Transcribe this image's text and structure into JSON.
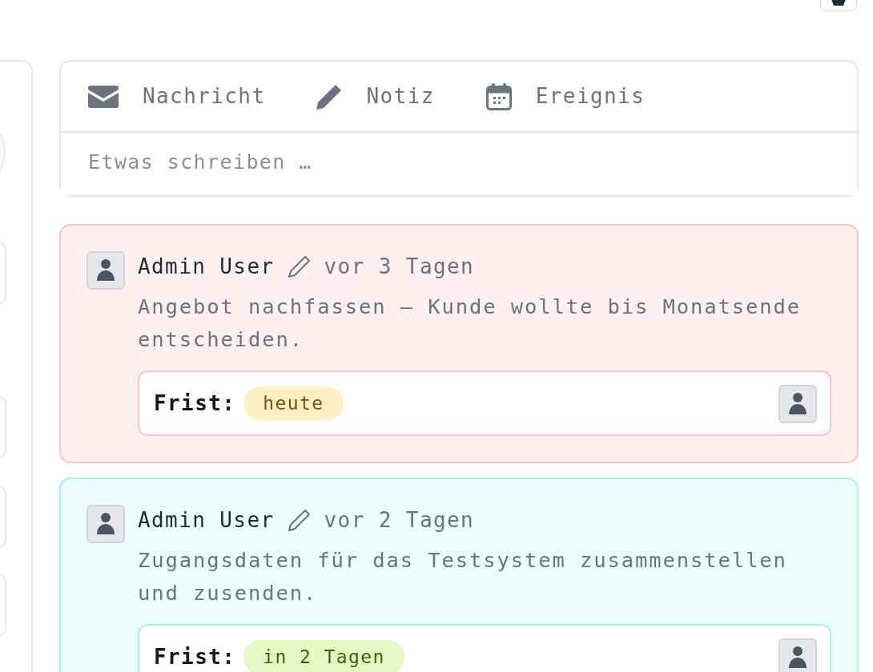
{
  "composer": {
    "tabs": [
      {
        "kind": "message",
        "label": "Nachricht"
      },
      {
        "kind": "note",
        "label": "Notiz"
      },
      {
        "kind": "event",
        "label": "Ereignis"
      }
    ],
    "placeholder": "Etwas schreiben …"
  },
  "tasks": [
    {
      "kind": "today",
      "author": "Admin User",
      "time": "vor 3 Tagen",
      "text": "Angebot nachfassen – Kunde wollte bis Monatsende entscheiden.",
      "deadline_label": "Frist:",
      "deadline": "heute"
    },
    {
      "kind": "soon",
      "author": "Admin User",
      "time": "vor 2 Tagen",
      "text": "Zugangsdaten für das Testsystem zusammenstellen und zusenden.",
      "deadline_label": "Frist:",
      "deadline": "in 2 Tagen"
    }
  ]
}
